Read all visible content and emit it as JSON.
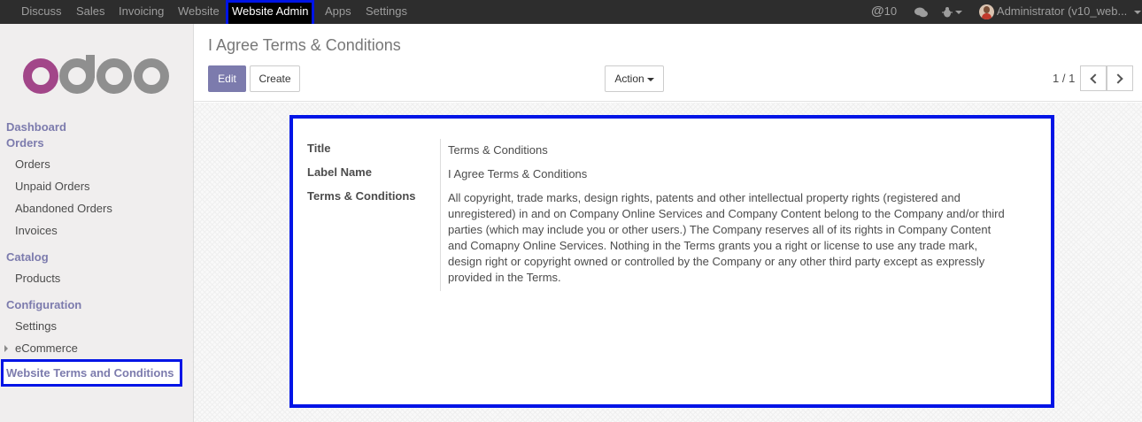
{
  "topbar": {
    "menus": [
      "Discuss",
      "Sales",
      "Invoicing",
      "Website",
      "Website Admin",
      "Apps",
      "Settings"
    ],
    "messages_count": "10",
    "user": "Administrator (v10_web..."
  },
  "sidebar": {
    "logo_text": "odoo",
    "dashboard": "Dashboard",
    "orders_head": "Orders",
    "orders_items": [
      "Orders",
      "Unpaid Orders",
      "Abandoned Orders",
      "Invoices"
    ],
    "catalog_head": "Catalog",
    "catalog_items": [
      "Products"
    ],
    "config_head": "Configuration",
    "config_items": [
      "Settings",
      "eCommerce"
    ],
    "terms_item": "Website Terms and Conditions"
  },
  "control": {
    "breadcrumb": "I Agree Terms & Conditions",
    "edit": "Edit",
    "create": "Create",
    "action": "Action",
    "pager": "1 / 1"
  },
  "form": {
    "title_label": "Title",
    "title_value": "Terms & Conditions",
    "label_name_label": "Label Name",
    "label_name_value": "I Agree Terms & Conditions",
    "terms_label": "Terms & Conditions",
    "terms_lines": [
      "All copyright, trade marks, design rights, patents and other intellectual property rights (registered and",
      "unregistered) in and on Company Online Services and Company Content belong to the Company and/or third",
      "parties (which may include you or other users.) The Company reserves all of its rights in Company Content",
      "and Comapny Online Services. Nothing in the Terms grants you a right or license to use any trade mark,",
      "design right or copyright owned or controlled by the Company or any other third party except as expressly",
      "provided in the Terms."
    ]
  },
  "colors": {
    "brand": "#7c7bad",
    "highlight": "#0014e6",
    "topbar": "#2d2d2d"
  }
}
